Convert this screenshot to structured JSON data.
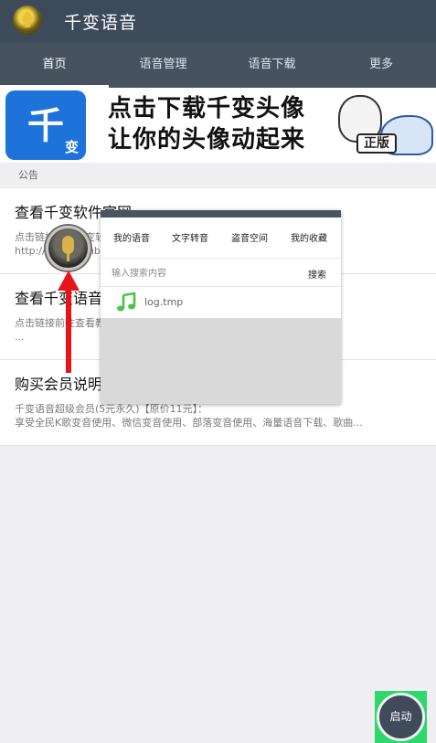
{
  "app": {
    "title": "千变语音"
  },
  "tabs": [
    {
      "label": "首页",
      "active": true
    },
    {
      "label": "语音管理",
      "active": false
    },
    {
      "label": "语音下载",
      "active": false
    },
    {
      "label": "更多",
      "active": false
    }
  ],
  "banner": {
    "icon_big": "千",
    "icon_small": "变",
    "line1": "点击下载千变头像",
    "line2": "让你的头像动起来",
    "art_tag": "正版"
  },
  "section": {
    "label": "公告"
  },
  "announcements": [
    {
      "title": "查看千变软件官网",
      "desc_line1": "点击链接前往千变软件官网",
      "desc_line2": "http://www.qianbianxl.com"
    },
    {
      "title": "查看千变语音教程",
      "desc_line1": "点击链接前往查看教程",
      "desc_line2": "..."
    },
    {
      "title": "购买会员说明",
      "desc_line1": "千变语音超级会员(5元永久)【原价11元】：",
      "desc_line2": "享受全民K歌变音使用、微信变音使用、部落变音使用、海量语音下载、歌曲..."
    }
  ],
  "popup": {
    "tabs": [
      "我的语音",
      "文字转音",
      "盗音空间",
      "我的收藏"
    ],
    "search_placeholder": "输入搜索内容",
    "search_button": "搜索",
    "files": [
      {
        "name": "log.tmp",
        "icon": "music-note-icon"
      }
    ]
  },
  "start_button": {
    "label": "启动"
  },
  "colors": {
    "appbar": "#3d4a5a",
    "tabbar": "#46535f",
    "accent_green": "#2fd86a",
    "arrow_red": "#e8141b"
  }
}
